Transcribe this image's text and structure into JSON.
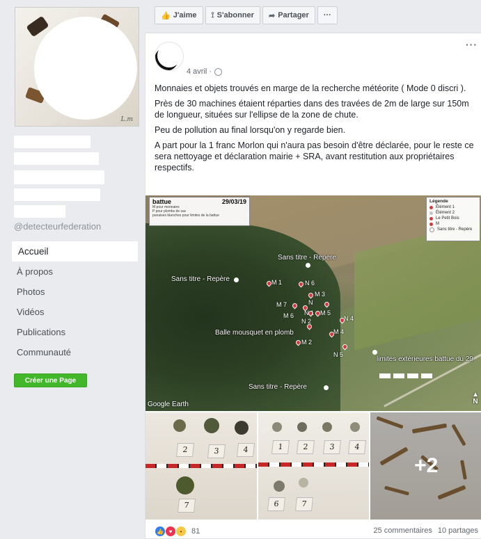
{
  "sidebar": {
    "handle": "@detecteurfederation",
    "nav": [
      {
        "label": "Accueil",
        "active": true
      },
      {
        "label": "À propos"
      },
      {
        "label": "Photos"
      },
      {
        "label": "Vidéos"
      },
      {
        "label": "Publications"
      },
      {
        "label": "Communauté"
      }
    ],
    "create_page_label": "Créer une Page"
  },
  "actionbar": {
    "like_label": "J'aime",
    "subscribe_label": "S'abonner",
    "share_label": "Partager",
    "more_label": "···"
  },
  "post": {
    "time": "4 avril ·",
    "more_label": "···",
    "paragraphs": [
      "Monnaies et objets trouvés en marge de la recherche météorite ( Mode 0 discri ).",
      "Près de 30 machines étaient réparties dans des travées de 2m de large sur 150m de longueur, situées sur l'ellipse de la zone de chute.",
      "Peu de pollution au final lorsqu'on y regarde bien.",
      "A part pour la 1 franc Morlon qui n'aura pas besoin d'être déclarée, pour le reste ce sera nettoyage et déclaration mairie + SRA, avant restitution aux propriétaires respectifs."
    ],
    "map": {
      "title": "battue",
      "date": "29/03/19",
      "subtitle_lines": [
        "M pour monnaies",
        "P pour plombs de sac",
        "punaises blanches pour limites de la battue"
      ],
      "legend_title": "Légende",
      "legend_items": [
        {
          "label": "Élément 1",
          "color": "#d9363e"
        },
        {
          "label": "Élément 2",
          "color": "#c8c8c8"
        },
        {
          "label": "Le Petit Bois",
          "color": "#d9363e"
        },
        {
          "label": "M",
          "color": "#d9363e"
        },
        {
          "label": "Sans titre - Repère",
          "color": "#ffffff"
        }
      ],
      "labels": {
        "repere_top": "Sans titre - Repère",
        "repere_left": "Sans titre - Repère",
        "repere_bottom": "Sans titre - Repère",
        "balle": "Balle mousquet en plomb",
        "limites": "limites extérieures battue du 29",
        "google": "Google Earth",
        "north": "N"
      },
      "pins": [
        "M 1",
        "N 6",
        "M 3",
        "M 7",
        "N",
        "M 6",
        "N 1",
        "M 5",
        "N 4",
        "N 2",
        "M 4",
        "M 2",
        "N 5"
      ]
    },
    "thumb_tags": {
      "t1": [
        "2",
        "3",
        "4",
        "7"
      ],
      "t2": [
        "1",
        "2",
        "3",
        "4",
        "6",
        "7"
      ]
    },
    "more_photos": "+2",
    "reactions_count": "81",
    "comments": "25 commentaires",
    "shares": "10 partages"
  }
}
